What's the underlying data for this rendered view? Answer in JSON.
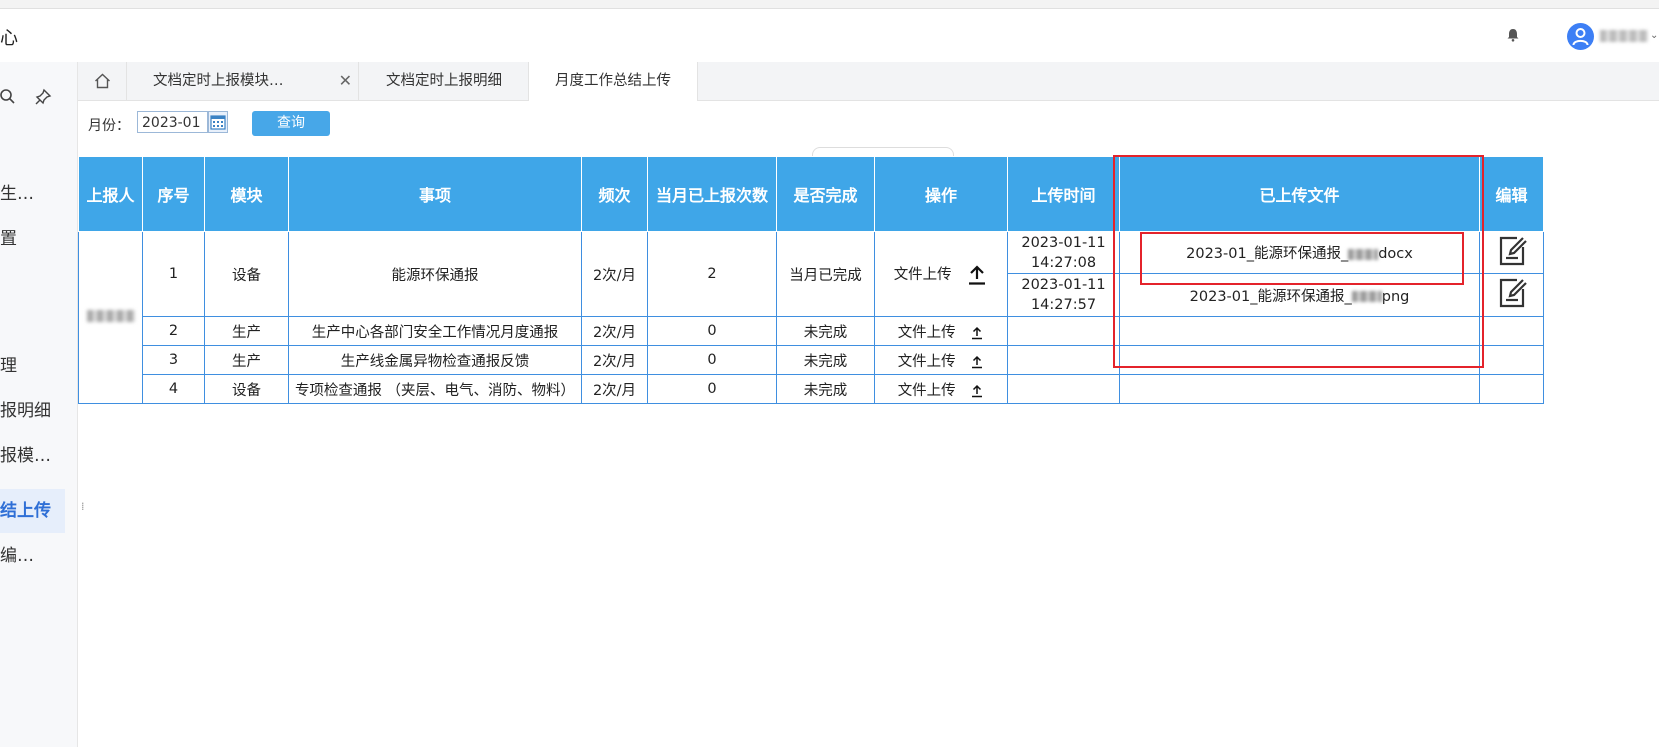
{
  "header": {
    "title": "心"
  },
  "sidebar": {
    "items": [
      {
        "label": "生…",
        "active": false
      },
      {
        "label": "置",
        "active": false
      },
      {
        "label": "理",
        "active": false
      },
      {
        "label": "报明细",
        "active": false
      },
      {
        "label": "报模…",
        "active": false
      },
      {
        "label": "结上传",
        "active": true
      },
      {
        "label": "编…",
        "active": false
      }
    ]
  },
  "tabs": [
    {
      "label": "文档定时上报模块…",
      "closable": true
    },
    {
      "label": "文档定时上报明细",
      "closable": false
    },
    {
      "label": "月度工作总结上传",
      "closable": false,
      "active": true
    }
  ],
  "filter": {
    "month_label": "月份：",
    "month_value": "2023-01",
    "query_label": "查询"
  },
  "table": {
    "headers": [
      "上报人",
      "序号",
      "模块",
      "事项",
      "频次",
      "当月已上报次数",
      "是否完成",
      "操作",
      "上传时间",
      "已上传文件",
      "编辑"
    ],
    "rows": [
      {
        "index": "1",
        "module": "设备",
        "item": "能源环保通报",
        "freq": "2次/月",
        "count": "2",
        "done": "当月已完成",
        "action": "文件上传",
        "uploads": [
          {
            "time": "2023-01-11 14:27:08",
            "file_prefix": "2023-01_能源环保通报_",
            "file_suffix": "docx"
          },
          {
            "time": "2023-01-11 14:27:57",
            "file_prefix": "2023-01_能源环保通报_",
            "file_suffix": "png"
          }
        ]
      },
      {
        "index": "2",
        "module": "生产",
        "item": "生产中心各部门安全工作情况月度通报",
        "freq": "2次/月",
        "count": "0",
        "done": "未完成",
        "action": "文件上传"
      },
      {
        "index": "3",
        "module": "生产",
        "item": "生产线金属异物检查通报反馈",
        "freq": "2次/月",
        "count": "0",
        "done": "未完成",
        "action": "文件上传"
      },
      {
        "index": "4",
        "module": "设备",
        "item": "专项检查通报 （夹层、电气、消防、物料）",
        "freq": "2次/月",
        "count": "0",
        "done": "未完成",
        "action": "文件上传"
      }
    ]
  },
  "colors": {
    "header_bg": "#3fa6e8",
    "border": "#3f8fe0",
    "highlight": "#e4232b",
    "button": "#47a7e8"
  }
}
